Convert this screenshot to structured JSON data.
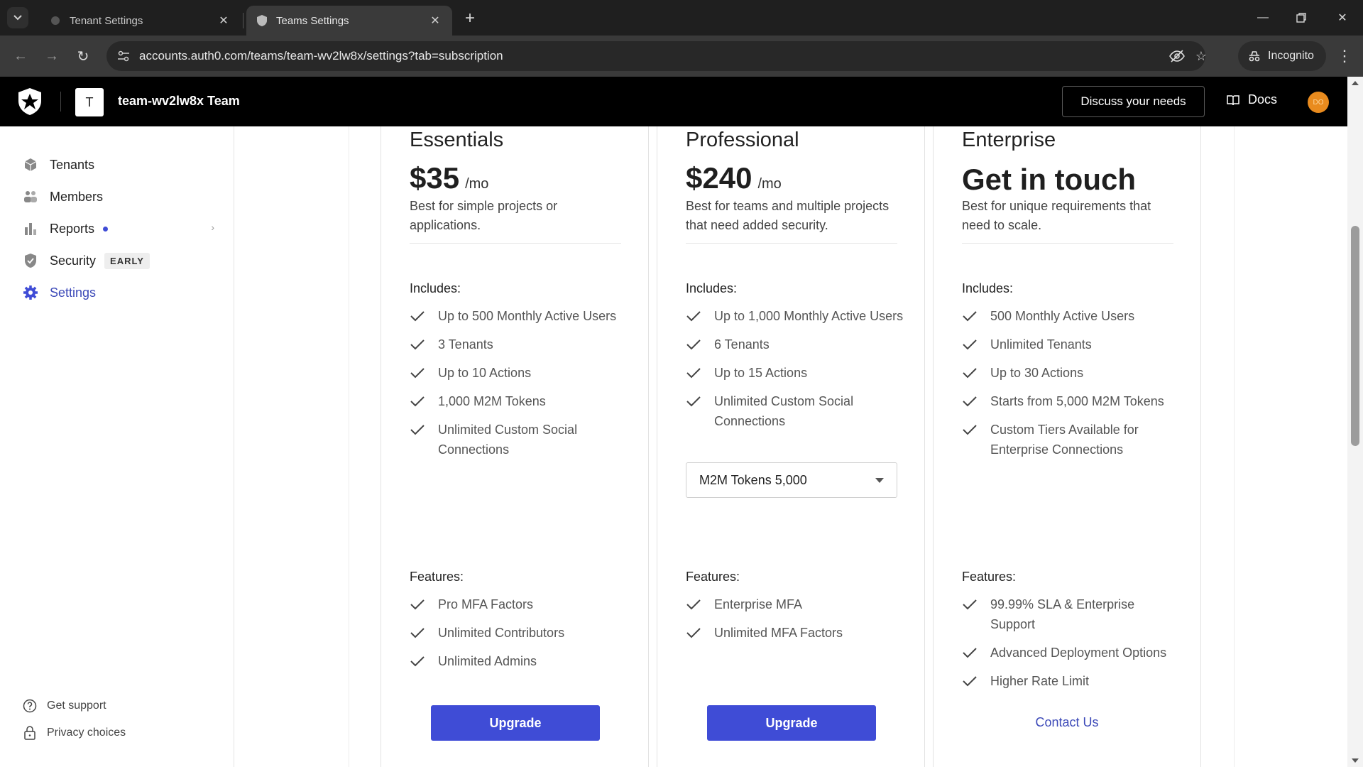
{
  "browser": {
    "tabs": [
      {
        "title": "Tenant Settings",
        "active": false
      },
      {
        "title": "Teams Settings",
        "active": true
      }
    ],
    "url": "accounts.auth0.com/teams/team-wv2lw8x/settings?tab=subscription",
    "incognito_label": "Incognito"
  },
  "header": {
    "team_initial": "T",
    "team_name": "team-wv2lw8x Team",
    "discuss_label": "Discuss your needs",
    "docs_label": "Docs",
    "user_initials": "DO"
  },
  "sidebar": {
    "items": [
      {
        "label": "Tenants",
        "icon": "cube-icon"
      },
      {
        "label": "Members",
        "icon": "members-icon"
      },
      {
        "label": "Reports",
        "icon": "bar-chart-icon"
      },
      {
        "label": "Security",
        "icon": "shield-icon",
        "badge": "EARLY"
      },
      {
        "label": "Settings",
        "icon": "gear-icon",
        "active": true
      }
    ],
    "footer": [
      {
        "label": "Get support",
        "icon": "help-circle-icon"
      },
      {
        "label": "Privacy choices",
        "icon": "lock-icon"
      }
    ]
  },
  "plans": [
    {
      "name": "Essentials",
      "price": "$35",
      "per": "/mo",
      "description": "Best for simple projects or applications.",
      "includes_label": "Includes:",
      "includes": [
        "Up to 500 Monthly Active Users",
        "3 Tenants",
        "Up to 10 Actions",
        "1,000 M2M Tokens",
        "Unlimited Custom Social Connections"
      ],
      "features_label": "Features:",
      "features": [
        "Pro MFA Factors",
        "Unlimited Contributors",
        "Unlimited Admins"
      ],
      "cta": "Upgrade"
    },
    {
      "name": "Professional",
      "price": "$240",
      "per": "/mo",
      "description": "Best for teams and multiple projects that need added security.",
      "includes_label": "Includes:",
      "includes": [
        "Up to 1,000 Monthly Active Users",
        "6 Tenants",
        "Up to 15 Actions",
        "Unlimited Custom Social Connections"
      ],
      "select_value": "M2M Tokens 5,000",
      "features_label": "Features:",
      "features": [
        "Enterprise MFA",
        "Unlimited MFA Factors"
      ],
      "cta": "Upgrade"
    },
    {
      "name": "Enterprise",
      "price": "Get in touch",
      "description": "Best for unique requirements that need to scale.",
      "includes_label": "Includes:",
      "includes": [
        "500 Monthly Active Users",
        "Unlimited Tenants",
        "Up to 30 Actions",
        "Starts from 5,000 M2M Tokens",
        "Custom Tiers Available for Enterprise Connections"
      ],
      "features_label": "Features:",
      "features": [
        "99.99% SLA & Enterprise Support",
        "Advanced Deployment Options",
        "Higher Rate Limit"
      ],
      "cta": "Contact Us"
    }
  ],
  "colors": {
    "accent": "#3f4cd6",
    "active_nav": "#3c49b8",
    "appbar": "#000000"
  }
}
